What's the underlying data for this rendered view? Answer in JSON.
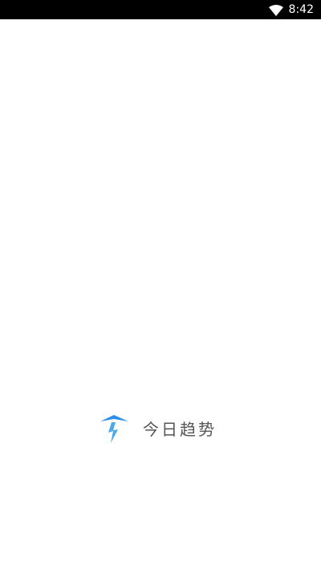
{
  "status_bar": {
    "time": "8:42",
    "wifi_icon": "wifi-icon"
  },
  "splash": {
    "logo_icon": "lightning-arrow-logo-icon",
    "app_name": "今日趋势"
  },
  "colors": {
    "status_bar_bg": "#000000",
    "background": "#ffffff",
    "logo_blue": "#2f8fe6",
    "text": "#555555"
  }
}
